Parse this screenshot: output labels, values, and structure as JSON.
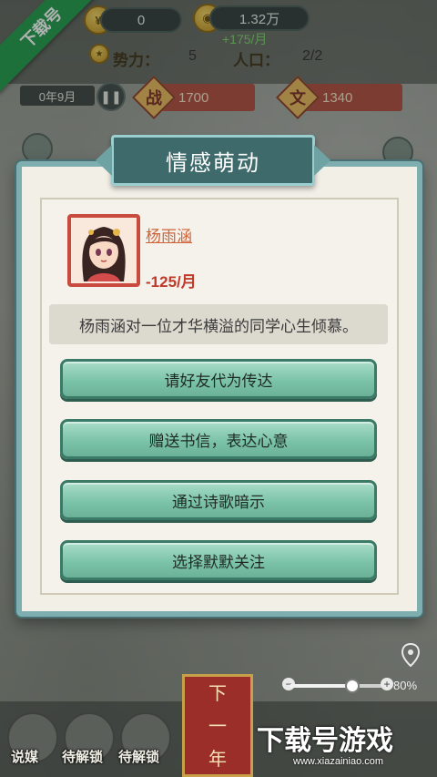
{
  "topbar": {
    "resource1_value": "0",
    "resource2_value": "1.32万",
    "income": "+175/月",
    "power_label": "势力：",
    "power_value": "5",
    "population_label": "人口：",
    "population_value": "2/2",
    "corner_badge": "下载号"
  },
  "status": {
    "date": "0年9月",
    "war_label": "战",
    "war_value": "1700",
    "culture_label": "文",
    "culture_value": "1340"
  },
  "dialog": {
    "title": "情感萌动",
    "character": {
      "name": "杨雨涵",
      "monthly": "-125/月"
    },
    "description": "杨雨涵对一位才华横溢的同学心生倾慕。",
    "options": [
      {
        "label": "请好友代为传达"
      },
      {
        "label": "赠送书信，表达心意"
      },
      {
        "label": "通过诗歌暗示"
      },
      {
        "label": "选择默默关注"
      }
    ]
  },
  "bottom": {
    "btn1": "说媒",
    "btn2": "待解锁",
    "btn3": "待解锁",
    "next_top": "下",
    "next_bottom": "一",
    "next_last": "年",
    "zoom": "80%",
    "zoom_level": 0.68
  },
  "watermark": {
    "logo": "下载号游戏",
    "url": "www.xiazainiao.com"
  },
  "colors": {
    "accent": "#7cc4a9",
    "title_plate": "#3e6a6b",
    "name": "#d0633a",
    "negative": "#c0392b"
  }
}
